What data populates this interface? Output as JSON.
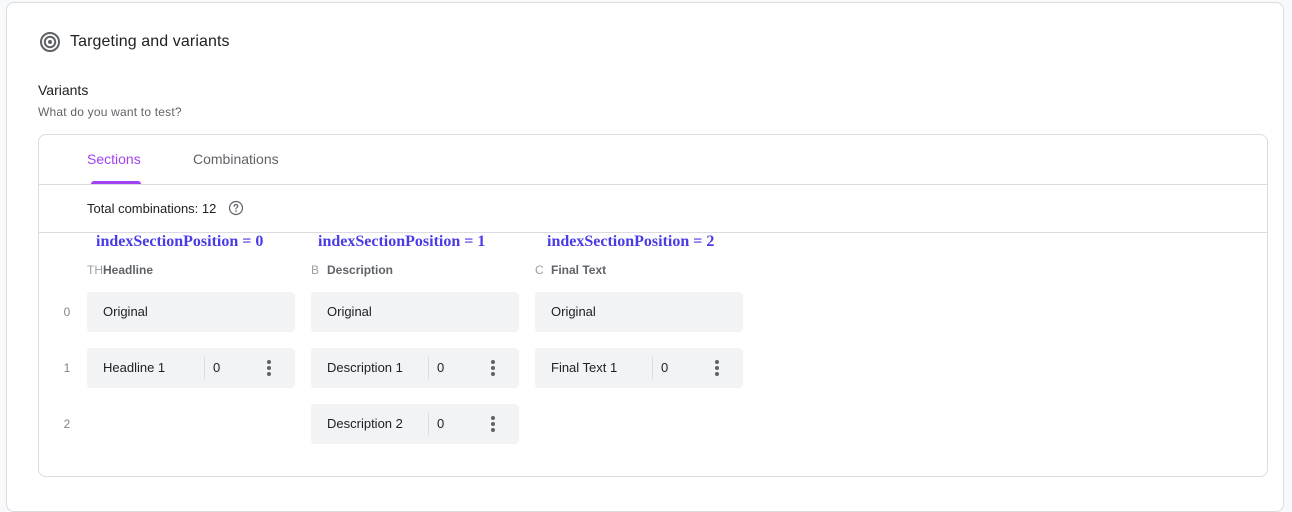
{
  "header": {
    "title": "Targeting and variants",
    "icon": "target-icon"
  },
  "variants": {
    "label": "Variants",
    "subtitle": "What do you want to test?"
  },
  "tabs": [
    {
      "label": "Sections",
      "active": true
    },
    {
      "label": "Combinations",
      "active": false
    }
  ],
  "total": {
    "text": "Total combinations: 12",
    "help_icon": "help-circle-icon"
  },
  "annotations": [
    "indexSectionPosition = 0",
    "indexSectionPosition = 1",
    "indexSectionPosition = 2"
  ],
  "sections": [
    {
      "letter": "TH",
      "name": "Headline"
    },
    {
      "letter": "B",
      "name": "Description"
    },
    {
      "letter": "C",
      "name": "Final Text"
    }
  ],
  "row_numbers": [
    "0",
    "1",
    "2"
  ],
  "cells": {
    "headline": [
      {
        "text": "Original"
      },
      {
        "text": "Headline 1",
        "count": "0"
      }
    ],
    "description": [
      {
        "text": "Original"
      },
      {
        "text": "Description 1",
        "count": "0"
      },
      {
        "text": "Description 2",
        "count": "0"
      }
    ],
    "final_text": [
      {
        "text": "Original"
      },
      {
        "text": "Final Text 1",
        "count": "0"
      }
    ]
  },
  "colors": {
    "accent": "#a142f4",
    "annotation": "#4a3be6",
    "cell_bg": "#f1f3f4"
  }
}
